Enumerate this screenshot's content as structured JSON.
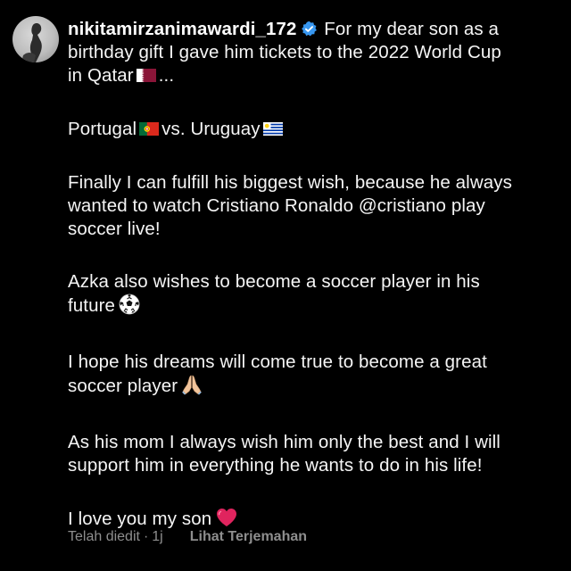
{
  "post": {
    "username": "nikitamirzanimawardi_172",
    "verified_icon": "verified-badge-icon",
    "caption_lines": {
      "p1_l1": "For my dear son as a",
      "p1_l2": "birthday gift I gave him tickets to the 2022 World Cup",
      "p1_l3a": "in Qatar",
      "p1_l3b": "...",
      "p2_a": "Portugal",
      "p2_b": "vs. Uruguay",
      "p3_l1": "Finally I can fulfill his biggest wish, because he always",
      "p3_l2": "wanted to watch Cristiano Ronaldo @cristiano play",
      "p3_l3": "soccer live!",
      "p4_l1": "Azka also wishes to become a soccer player in his",
      "p4_l2": "future",
      "p5_l1": "I hope his dreams will come true to become a great",
      "p5_l2": "soccer player",
      "p6_l1": "As his mom I always wish him only the best and I will",
      "p6_l2": "support him in everything he wants to do in his life!",
      "p7_l1": "I love you my son"
    }
  },
  "footer": {
    "edited": "Telah diedit",
    "separator": "·",
    "time": "1j",
    "translate": "Lihat Terjemahan"
  },
  "icons": {
    "qatar_flag": "qatar-flag-icon",
    "portugal_flag": "portugal-flag-icon",
    "uruguay_flag": "uruguay-flag-icon",
    "soccer_ball": "soccer-ball-icon",
    "praying_hands": "praying-hands-icon",
    "heart": "red-heart-icon"
  },
  "colors": {
    "background": "#000000",
    "text": "#f5f5f5",
    "muted": "#8e8e8e",
    "verified_blue": "#3897f0",
    "heart_red": "#e0245e"
  }
}
